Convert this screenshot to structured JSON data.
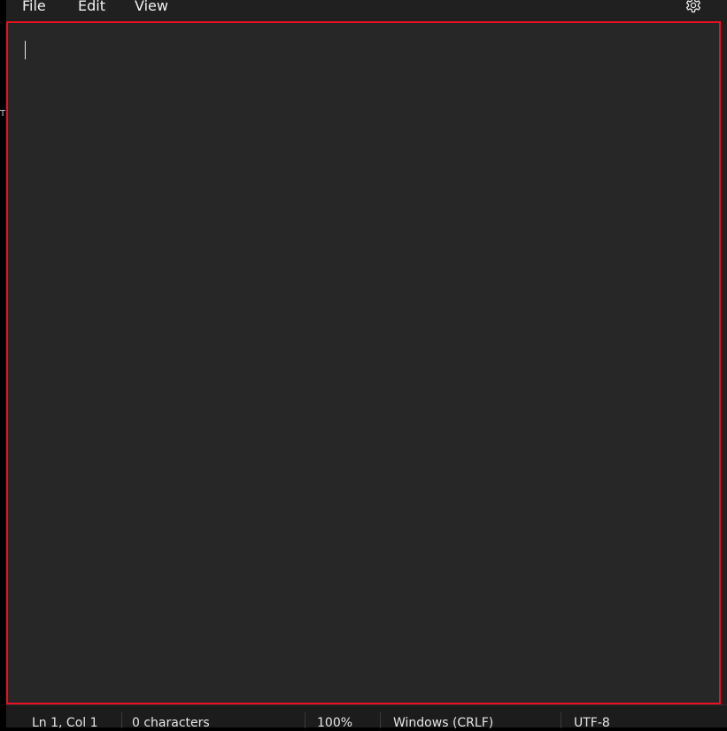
{
  "menu": {
    "file": "File",
    "edit": "Edit",
    "view": "View",
    "settings_icon": "gear-icon"
  },
  "editor": {
    "content": ""
  },
  "side_stub": {
    "text": "T"
  },
  "status": {
    "position": "Ln 1, Col 1",
    "characters": "0 characters",
    "zoom": "100%",
    "line_ending": "Windows (CRLF)",
    "encoding": "UTF-8"
  },
  "colors": {
    "focus_border": "#e81123",
    "editor_bg": "#272727",
    "chrome_bg": "#202020"
  }
}
